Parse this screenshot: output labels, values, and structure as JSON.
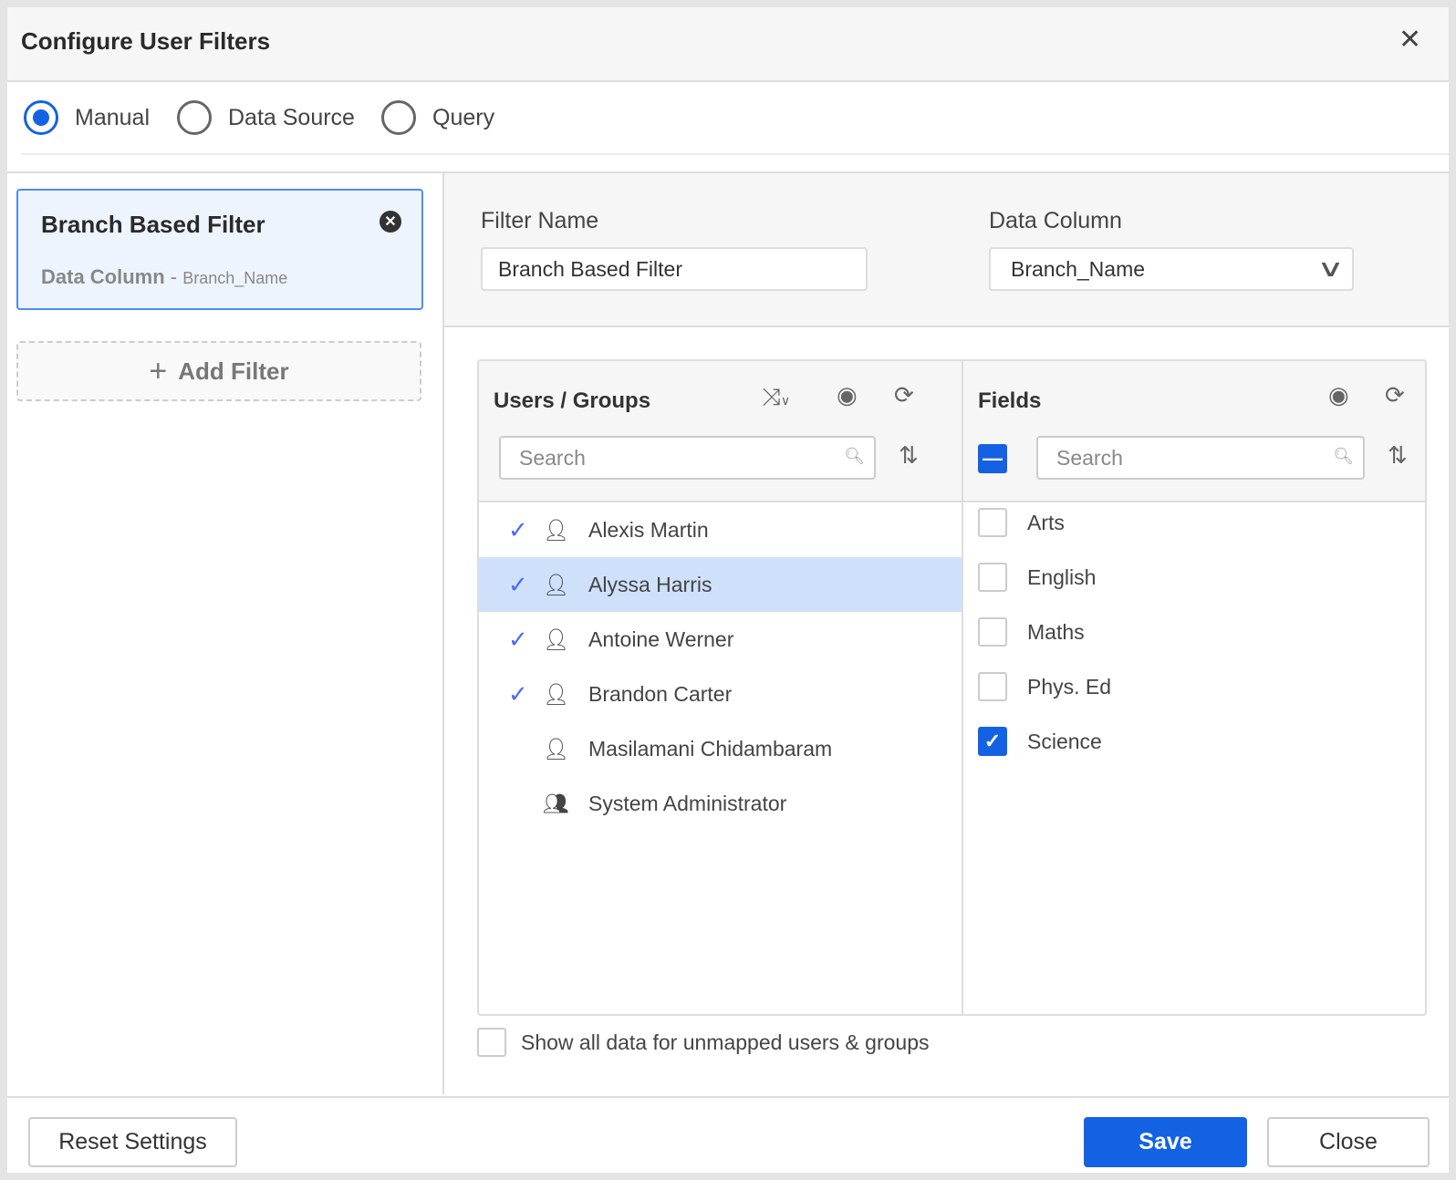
{
  "dialog": {
    "title": "Configure User Filters",
    "close_icon": "close-icon"
  },
  "mode": {
    "options": [
      "Manual",
      "Data Source",
      "Query"
    ],
    "selected": "Manual"
  },
  "filters": [
    {
      "name": "Branch Based Filter",
      "column_label": "Data Column",
      "column_value": "Branch_Name"
    }
  ],
  "add_filter_label": "Add Filter",
  "form": {
    "filter_name_label": "Filter Name",
    "filter_name_value": "Branch Based Filter",
    "data_column_label": "Data Column",
    "data_column_value": "Branch_Name"
  },
  "users": {
    "title": "Users / Groups",
    "search_placeholder": "Search",
    "items": [
      {
        "name": "Alexis Martin",
        "checked": true,
        "type": "user"
      },
      {
        "name": "Alyssa Harris",
        "checked": true,
        "type": "user",
        "selected": true
      },
      {
        "name": "Antoine Werner",
        "checked": true,
        "type": "user"
      },
      {
        "name": "Brandon Carter",
        "checked": true,
        "type": "user"
      },
      {
        "name": "Masilamani Chidambaram",
        "checked": false,
        "type": "user"
      },
      {
        "name": "System Administrator",
        "checked": false,
        "type": "group"
      }
    ]
  },
  "fields": {
    "title": "Fields",
    "search_placeholder": "Search",
    "items": [
      {
        "name": "Arts",
        "checked": false
      },
      {
        "name": "English",
        "checked": false
      },
      {
        "name": "Maths",
        "checked": false
      },
      {
        "name": "Phys. Ed",
        "checked": false
      },
      {
        "name": "Science",
        "checked": true
      }
    ]
  },
  "show_all_label": "Show all data for unmapped users & groups",
  "footer": {
    "reset": "Reset Settings",
    "save": "Save",
    "close": "Close"
  },
  "colors": {
    "accent": "#1462e4",
    "selected_row": "#cfe0fb",
    "card_bg": "#eef4fe"
  }
}
